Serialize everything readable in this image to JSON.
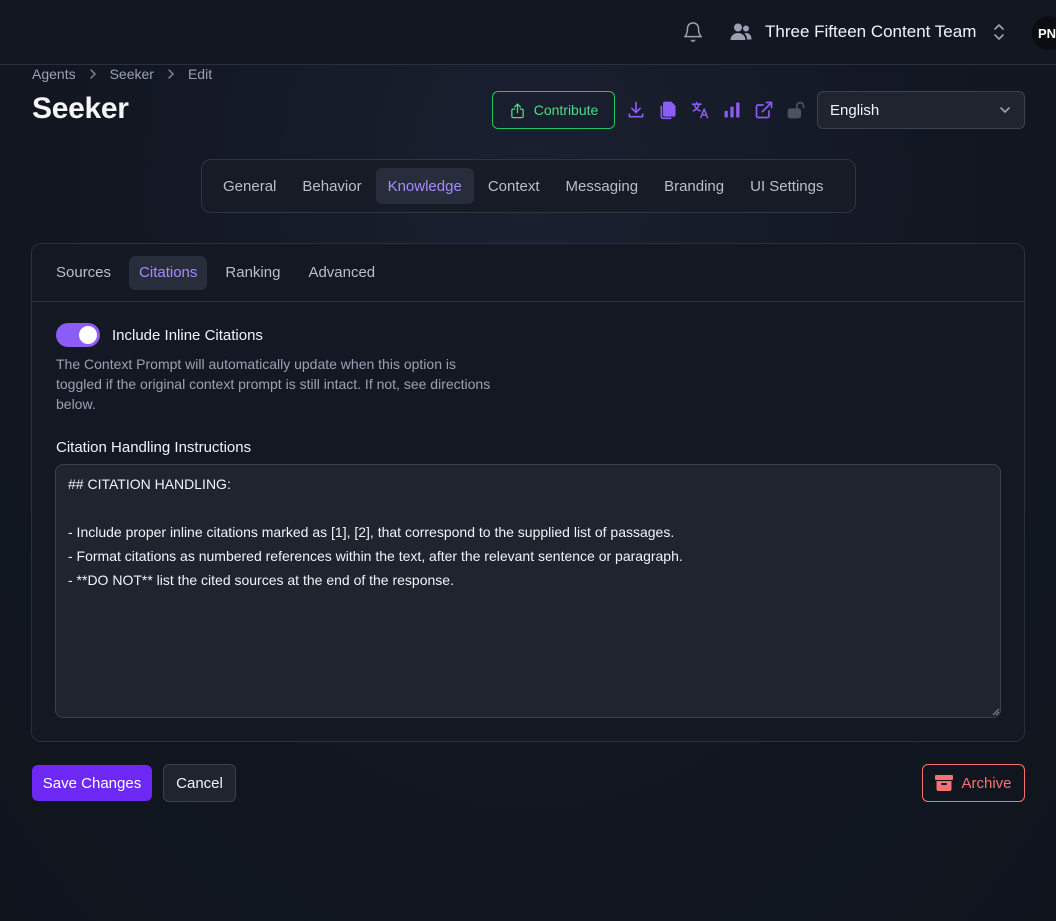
{
  "header": {
    "team_name": "Three Fifteen Content Team",
    "avatar_initials": "PN"
  },
  "breadcrumb": [
    "Agents",
    "Seeker",
    "Edit"
  ],
  "page": {
    "title": "Seeker",
    "contribute_label": "Contribute",
    "language": "English"
  },
  "icons": [
    "bell-icon",
    "users-icon",
    "chevron-up-down-icon",
    "upload-icon",
    "download-icon",
    "copy-icon",
    "translate-icon",
    "bar-chart-icon",
    "external-link-icon",
    "unlock-icon",
    "chevron-down-icon",
    "archive-icon"
  ],
  "colors": {
    "accent": "#8b5cf6",
    "accent_text": "#a78bfa",
    "primary_button": "#6d28f5",
    "contribute": "#22c55e",
    "danger": "#f87171"
  },
  "main_tabs": [
    {
      "label": "General"
    },
    {
      "label": "Behavior"
    },
    {
      "label": "Knowledge"
    },
    {
      "label": "Context"
    },
    {
      "label": "Messaging"
    },
    {
      "label": "Branding"
    },
    {
      "label": "UI Settings"
    }
  ],
  "main_tabs_active": "Knowledge",
  "sub_tabs": [
    {
      "label": "Sources"
    },
    {
      "label": "Citations"
    },
    {
      "label": "Ranking"
    },
    {
      "label": "Advanced"
    }
  ],
  "sub_tabs_active": "Citations",
  "citations": {
    "toggle_label": "Include Inline Citations",
    "toggle_on": true,
    "help_text": "The Context Prompt will automatically update when this option is toggled if the original context prompt is still intact. If not, see directions below.",
    "field_label": "Citation Handling Instructions",
    "instructions": "## CITATION HANDLING:\n\n- Include proper inline citations marked as [1], [2], that correspond to the supplied list of passages.\n- Format citations as numbered references within the text, after the relevant sentence or paragraph.\n- **DO NOT** list the cited sources at the end of the response."
  },
  "actions": {
    "save_label": "Save Changes",
    "cancel_label": "Cancel",
    "archive_label": "Archive"
  }
}
